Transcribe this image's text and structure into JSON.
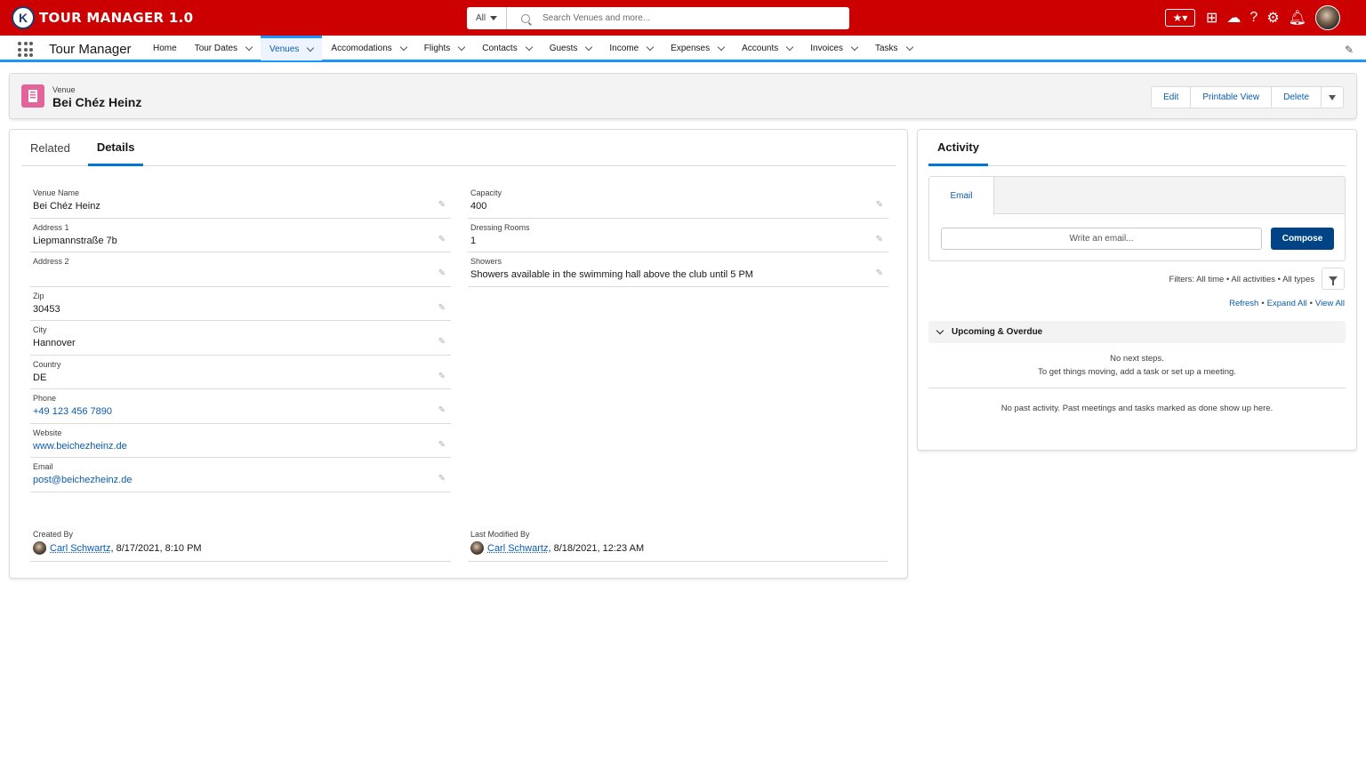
{
  "header": {
    "logo_letter": "K",
    "logo_text": "TOUR MANAGER 1.0",
    "search_scope": "All",
    "search_placeholder": "Search Venues and more..."
  },
  "nav": {
    "app_name": "Tour Manager",
    "items": [
      {
        "label": "Home",
        "dropdown": false,
        "active": false
      },
      {
        "label": "Tour Dates",
        "dropdown": true,
        "active": false
      },
      {
        "label": "Venues",
        "dropdown": true,
        "active": true
      },
      {
        "label": "Accomodations",
        "dropdown": true,
        "active": false
      },
      {
        "label": "Flights",
        "dropdown": true,
        "active": false
      },
      {
        "label": "Contacts",
        "dropdown": true,
        "active": false
      },
      {
        "label": "Guests",
        "dropdown": true,
        "active": false
      },
      {
        "label": "Income",
        "dropdown": true,
        "active": false
      },
      {
        "label": "Expenses",
        "dropdown": true,
        "active": false
      },
      {
        "label": "Accounts",
        "dropdown": true,
        "active": false
      },
      {
        "label": "Invoices",
        "dropdown": true,
        "active": false
      },
      {
        "label": "Tasks",
        "dropdown": true,
        "active": false
      }
    ]
  },
  "record": {
    "type": "Venue",
    "title": "Bei Chéz Heinz",
    "actions": {
      "edit": "Edit",
      "printable": "Printable View",
      "delete": "Delete"
    }
  },
  "tabs": {
    "related": "Related",
    "details": "Details"
  },
  "fields": {
    "left": [
      {
        "label": "Venue Name",
        "value": "Bei Chéz Heinz",
        "link": false
      },
      {
        "label": "Address 1",
        "value": "Liepmannstraße 7b",
        "link": false
      },
      {
        "label": "Address 2",
        "value": "",
        "link": false
      },
      {
        "label": "Zip",
        "value": "30453",
        "link": false
      },
      {
        "label": "City",
        "value": "Hannover",
        "link": false
      },
      {
        "label": "Country",
        "value": "DE",
        "link": false
      },
      {
        "label": "Phone",
        "value": "+49 123 456 7890",
        "link": true
      },
      {
        "label": "Website",
        "value": "www.beichezheinz.de",
        "link": true
      },
      {
        "label": "Email",
        "value": "post@beichezheinz.de",
        "link": true
      }
    ],
    "right": [
      {
        "label": "Capacity",
        "value": "400",
        "link": false
      },
      {
        "label": "Dressing Rooms",
        "value": "1",
        "link": false
      },
      {
        "label": "Showers",
        "value": "Showers available in the swimming hall above the club until 5 PM",
        "link": false
      }
    ]
  },
  "system": {
    "created_label": "Created By",
    "created_user": "Carl Schwartz",
    "created_date": ", 8/17/2021, 8:10 PM",
    "modified_label": "Last Modified By",
    "modified_user": "Carl Schwartz",
    "modified_date": ", 8/18/2021, 12:23 AM"
  },
  "activity": {
    "title": "Activity",
    "email_tab": "Email",
    "write_placeholder": "Write an email...",
    "compose": "Compose",
    "filters": "Filters: All time • All activities • All types",
    "refresh": "Refresh",
    "expand_all": "Expand All",
    "view_all": "View All",
    "upcoming": "Upcoming & Overdue",
    "no_next_1": "No next steps.",
    "no_next_2": "To get things moving, add a task or set up a meeting.",
    "no_past": "No past activity. Past meetings and tasks marked as done show up here."
  }
}
